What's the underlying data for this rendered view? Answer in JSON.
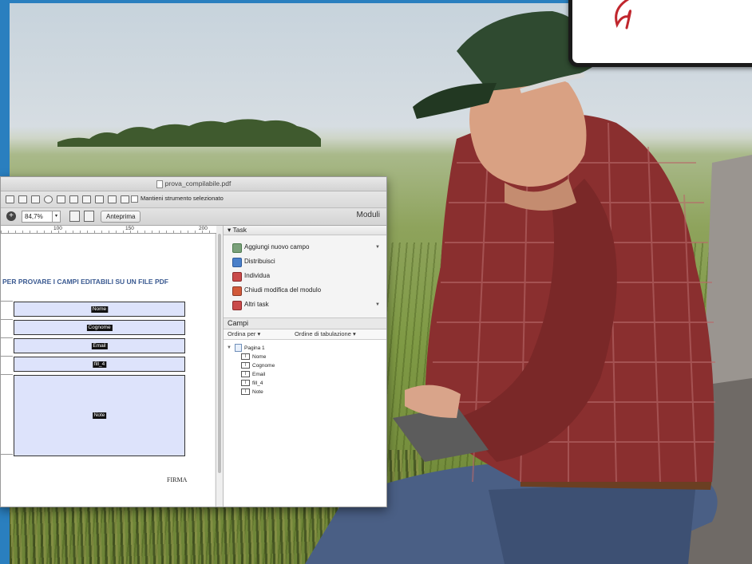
{
  "window": {
    "title": "prova_compilabile.pdf"
  },
  "toolbar": {
    "keep_tool_label": "Mantieni strumento selezionato",
    "zoom_value": "84,7%",
    "preview_label": "Anteprima",
    "panel_title": "Moduli"
  },
  "ruler": {
    "ticks": [
      "100",
      "150",
      "200"
    ]
  },
  "document": {
    "heading": "PER PROVARE I CAMPI EDITABILI SU UN FILE PDF",
    "fields": [
      "Nome",
      "Cognome",
      "Email",
      "fill_4",
      "Note"
    ],
    "signature_label": "FIRMA",
    "field_fill_color": "#dde3fb"
  },
  "tasks": {
    "header": "Task",
    "items": [
      {
        "label": "Aggiungi nuovo campo",
        "icon": "add-field-icon",
        "has_dropdown": true
      },
      {
        "label": "Distribuisci",
        "icon": "distribute-icon",
        "has_dropdown": false
      },
      {
        "label": "Individua",
        "icon": "locate-icon",
        "has_dropdown": false
      },
      {
        "label": "Chiudi modifica del modulo",
        "icon": "close-form-edit-icon",
        "has_dropdown": false
      },
      {
        "label": "Altri task",
        "icon": "more-tasks-icon",
        "has_dropdown": true
      }
    ]
  },
  "fields_panel": {
    "header": "Campi",
    "sort_by": "Ordina per",
    "tab_order": "Ordine di tabulazione",
    "tree": {
      "page": "Pagina 1",
      "children": [
        "Nome",
        "Cognome",
        "Email",
        "fill_4",
        "Note"
      ]
    }
  }
}
